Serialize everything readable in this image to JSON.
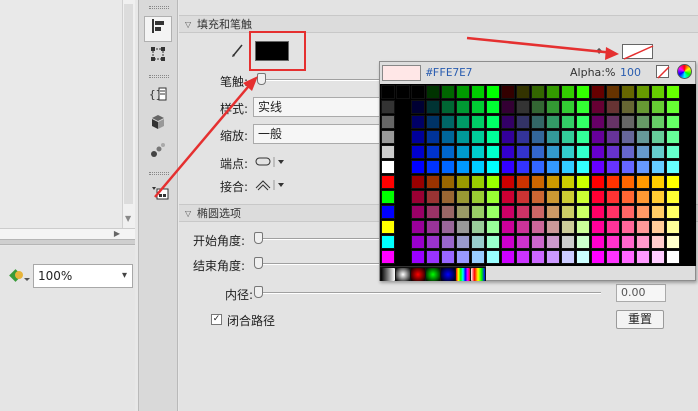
{
  "panel": {
    "fill_stroke": {
      "title": "填充和笔触"
    },
    "stroke_label": "笔触:",
    "style": {
      "label": "样式:",
      "value": "实线"
    },
    "scale": {
      "label": "缩放:",
      "value": "一般"
    },
    "cap_label": "端点:",
    "join_label": "接合:",
    "oval": {
      "title": "椭圆选项",
      "start_angle_label": "开始角度:",
      "end_angle_label": "结束角度:",
      "inner_radius_label": "内径:",
      "inner_radius_value": "0.00",
      "close_path_label": "闭合路径",
      "close_path_checked": true,
      "reset_label": "重置"
    }
  },
  "swatch_popup": {
    "hex": "#FFE7E7",
    "alpha_label": "Alpha:%",
    "alpha_value": "100",
    "preview_color": "#ffe7e7"
  },
  "stage": {
    "zoom": {
      "value": "100%"
    }
  },
  "colors": {
    "annotation_red": "#e53030",
    "link_blue": "#2a5db0"
  },
  "icons": [
    "align-icon",
    "transform-icon",
    "code-snippets-icon",
    "components-icon",
    "motion-presets-icon",
    "pencil-icon",
    "no-color-icon",
    "color-wheel-icon",
    "zoom-icon"
  ]
}
